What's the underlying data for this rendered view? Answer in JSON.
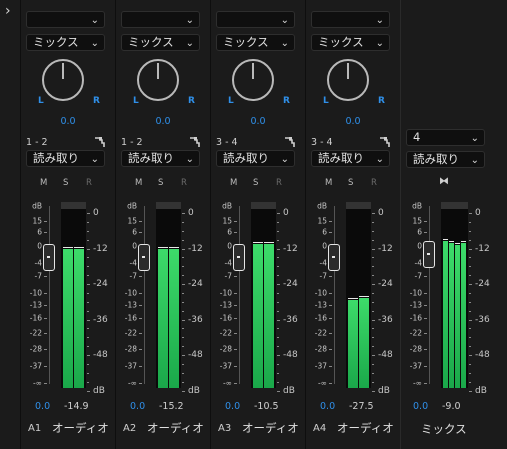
{
  "expand_icon": "chevron-right-icon",
  "colors": {
    "accent": "#2f8fe8",
    "meter_green": "#2ecf5a",
    "background": "#1b1b1b"
  },
  "left_scale_labels": [
    "dB",
    "15",
    "6",
    "0",
    "-4",
    "-7",
    "-10",
    "-13",
    "-16",
    "-22",
    "-28",
    "-37",
    "-∞"
  ],
  "right_scale_labels": [
    "0",
    "-12",
    "-24",
    "-36",
    "-48",
    "dB"
  ],
  "channels": [
    {
      "input": "",
      "mode": "ミックス",
      "pan_left": "L",
      "pan_right": "R",
      "pan_value": "0.0",
      "channel_map": "1 - 2",
      "automation": "読み取り",
      "mute": "M",
      "solo": "S",
      "record": "R",
      "volume": "0.0",
      "peak": "-14.9",
      "track_id": "A1",
      "track_name": "オーディオ",
      "meter_level_db": [
        -12.2,
        -12.2
      ],
      "meter_type": "stereo"
    },
    {
      "input": "",
      "mode": "ミックス",
      "pan_left": "L",
      "pan_right": "R",
      "pan_value": "0.0",
      "channel_map": "1 - 2",
      "automation": "読み取り",
      "mute": "M",
      "solo": "S",
      "record": "R",
      "volume": "0.0",
      "peak": "-15.2",
      "track_id": "A2",
      "track_name": "オーディオ",
      "meter_level_db": [
        -12.3,
        -12.3
      ],
      "meter_type": "stereo"
    },
    {
      "input": "",
      "mode": "ミックス",
      "pan_left": "L",
      "pan_right": "R",
      "pan_value": "0.0",
      "channel_map": "3 - 4",
      "automation": "読み取り",
      "mute": "M",
      "solo": "S",
      "record": "R",
      "volume": "0.0",
      "peak": "-10.5",
      "track_id": "A3",
      "track_name": "オーディオ",
      "meter_level_db": [
        -10.5,
        -10.5
      ],
      "meter_type": "stereo"
    },
    {
      "input": "",
      "mode": "ミックス",
      "pan_left": "L",
      "pan_right": "R",
      "pan_value": "0.0",
      "channel_map": "3 - 4",
      "automation": "読み取り",
      "mute": "M",
      "solo": "S",
      "record": "R",
      "volume": "0.0",
      "peak": "-27.5",
      "track_id": "A4",
      "track_name": "オーディオ",
      "meter_level_db": [
        -29.5,
        -28.8
      ],
      "meter_type": "stereo"
    }
  ],
  "master": {
    "channels": "4",
    "automation": "読み取り",
    "stereo_icon": "stereo-link-icon",
    "volume": "0.0",
    "peak": "-9.0",
    "name": "ミックス",
    "meter_level_db": [
      -9.5,
      -10.2,
      -10.8,
      -10.2
    ]
  }
}
